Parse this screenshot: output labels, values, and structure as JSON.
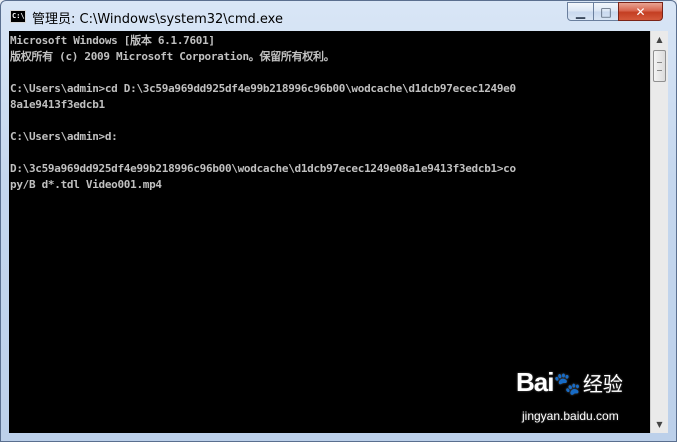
{
  "window": {
    "title": "管理员: C:\\Windows\\system32\\cmd.exe",
    "icon_text": "C:\\",
    "controls": {
      "minimize": "▁",
      "maximize": "□",
      "close": "✕"
    }
  },
  "console": {
    "lines": [
      "Microsoft Windows [版本 6.1.7601]",
      "版权所有 (c) 2009 Microsoft Corporation。保留所有权利。",
      "",
      "C:\\Users\\admin>cd D:\\3c59a969dd925df4e99b218996c96b00\\wodcache\\d1dcb97ecec1249e0",
      "8a1e9413f3edcb1",
      "",
      "C:\\Users\\admin>d:",
      "",
      "D:\\3c59a969dd925df4e99b218996c96b00\\wodcache\\d1dcb97ecec1249e08a1e9413f3edcb1>co",
      "py/B d*.tdl Video001.mp4"
    ]
  },
  "scrollbar": {
    "up_icon": "▲",
    "down_icon": "▼"
  },
  "watermark": {
    "brand": "Bai",
    "paw": "🐾",
    "cn": "经验",
    "url": "jingyan.baidu.com"
  }
}
